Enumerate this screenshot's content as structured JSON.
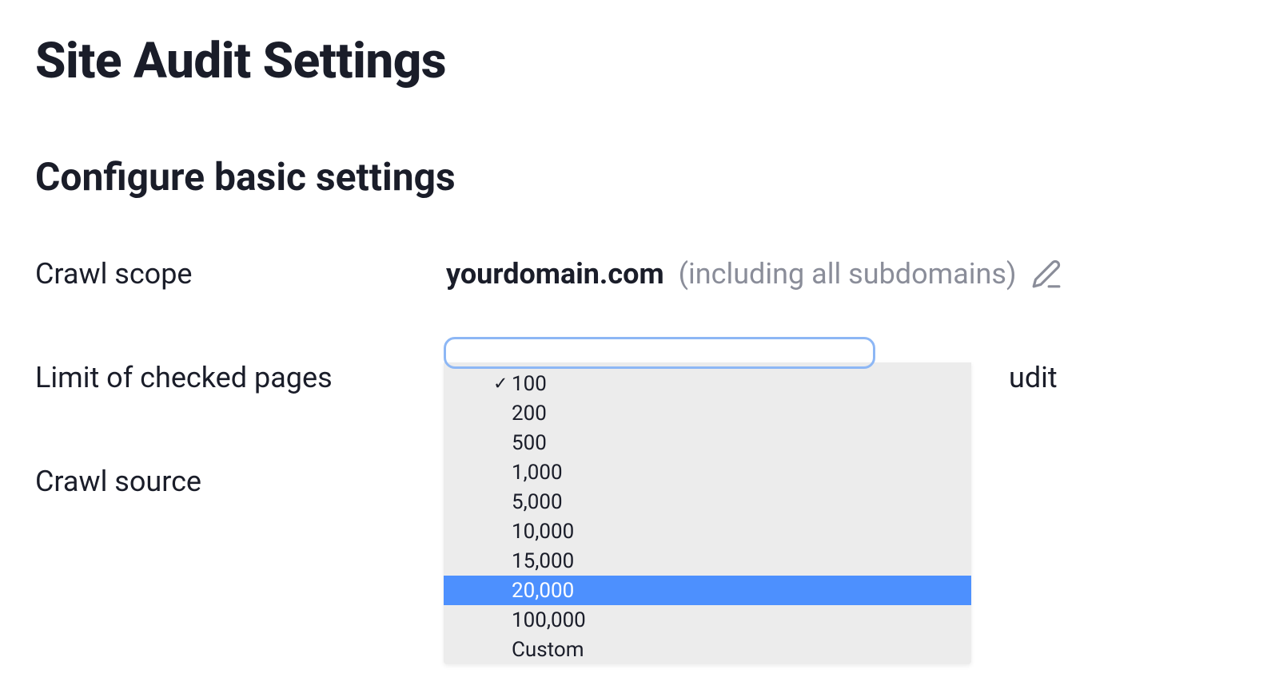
{
  "page_title": "Site Audit Settings",
  "section_title": "Configure basic settings",
  "settings": {
    "crawl_scope": {
      "label": "Crawl scope",
      "domain": "yourdomain.com",
      "suffix": "(including all subdomains)"
    },
    "limit_checked_pages": {
      "label": "Limit of checked pages",
      "trailing": "udit"
    },
    "crawl_source": {
      "label": "Crawl source"
    }
  },
  "dropdown": {
    "options": [
      {
        "label": "100",
        "checked": true,
        "highlighted": false
      },
      {
        "label": "200",
        "checked": false,
        "highlighted": false
      },
      {
        "label": "500",
        "checked": false,
        "highlighted": false
      },
      {
        "label": "1,000",
        "checked": false,
        "highlighted": false
      },
      {
        "label": "5,000",
        "checked": false,
        "highlighted": false
      },
      {
        "label": "10,000",
        "checked": false,
        "highlighted": false
      },
      {
        "label": "15,000",
        "checked": false,
        "highlighted": false
      },
      {
        "label": "20,000",
        "checked": false,
        "highlighted": true
      },
      {
        "label": "100,000",
        "checked": false,
        "highlighted": false
      },
      {
        "label": "Custom",
        "checked": false,
        "highlighted": false
      }
    ]
  }
}
